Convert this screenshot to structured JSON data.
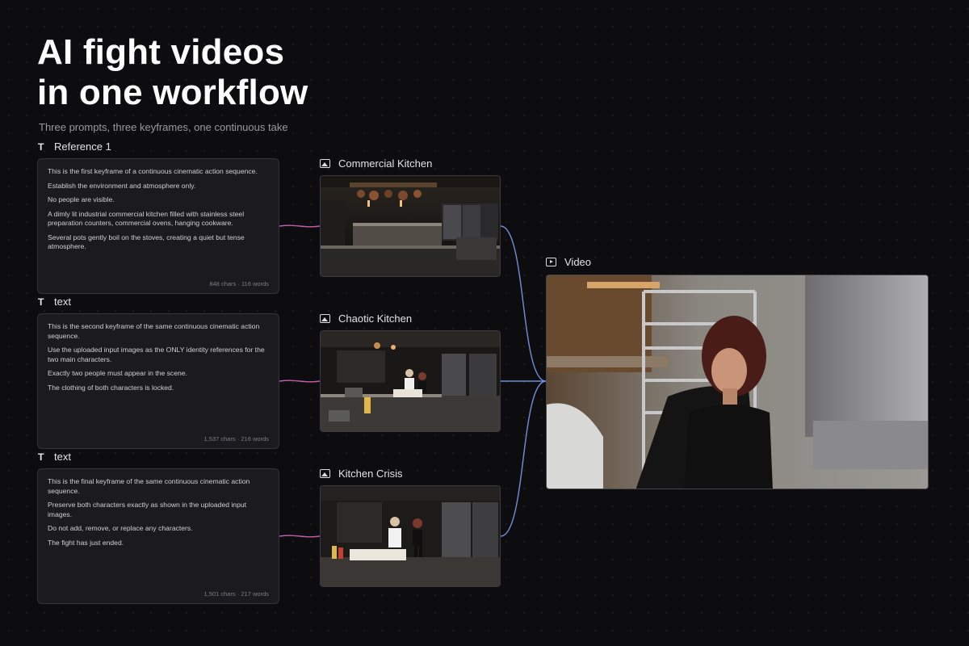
{
  "header": {
    "title_line1": "AI fight videos",
    "title_line2": "in one workflow",
    "subtitle": "Three prompts, three keyframes, one continuous take"
  },
  "text_nodes": [
    {
      "icon": "text-type-icon",
      "label": "Reference 1",
      "paragraphs": [
        "This is the first keyframe of a continuous cinematic action sequence.",
        "Establish the environment and atmosphere only.",
        "No people are visible.",
        "A dimly lit industrial commercial kitchen filled with stainless steel preparation counters, commercial ovens, hanging cookware.",
        "Several pots gently boil on the stoves, creating a quiet but tense atmosphere."
      ],
      "meta": "848 chars · 116 words"
    },
    {
      "icon": "text-type-icon",
      "label": "text",
      "paragraphs": [
        "This is the second keyframe of the same continuous cinematic action sequence.",
        "Use the uploaded input images as the ONLY identity references for the two main characters.",
        "Exactly two people must appear in the scene.",
        "The clothing of both characters is locked."
      ],
      "meta": "1,537 chars · 216 words"
    },
    {
      "icon": "text-type-icon",
      "label": "text",
      "paragraphs": [
        "This is the final keyframe of the same continuous cinematic action sequence.",
        "Preserve both characters exactly as shown in the uploaded input images.",
        "Do not add, remove, or replace any characters.",
        "The fight has just ended."
      ],
      "meta": "1,501 chars · 217 words"
    }
  ],
  "image_nodes": [
    {
      "icon": "image-icon",
      "label": "Commercial Kitchen"
    },
    {
      "icon": "image-icon",
      "label": "Chaotic Kitchen"
    },
    {
      "icon": "image-icon",
      "label": "Kitchen Crisis"
    }
  ],
  "video_node": {
    "icon": "video-icon",
    "label": "Video"
  },
  "colors": {
    "background": "#0d0d0f",
    "text_to_image_edge": "#c05aa8",
    "image_to_video_edge": "#6f8fd8",
    "card_background": "#1b1b1f"
  }
}
